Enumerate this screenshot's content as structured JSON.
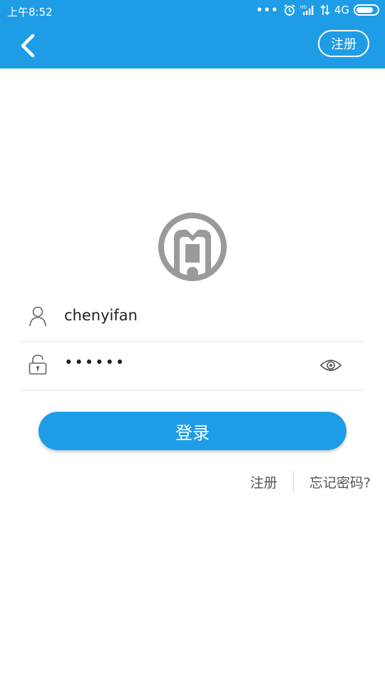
{
  "status_bar": {
    "time": "上午8:52",
    "network": "4G",
    "icons": [
      "more-dots-icon",
      "alarm-icon",
      "hd-signal-icon",
      "data-arrows-icon",
      "battery-icon"
    ]
  },
  "header": {
    "back_icon": "chevron-left-icon",
    "register_label": "注册"
  },
  "form": {
    "username": {
      "icon": "user-icon",
      "value": "chenyifan"
    },
    "password": {
      "icon": "lock-icon",
      "masked_value": "••••••",
      "toggle_icon": "eye-icon"
    }
  },
  "login_button": {
    "label": "登录"
  },
  "links": {
    "register": "注册",
    "forgot_password": "忘记密码?"
  },
  "colors": {
    "primary": "#1e9de6",
    "logo_gray": "#9a9a9a"
  }
}
